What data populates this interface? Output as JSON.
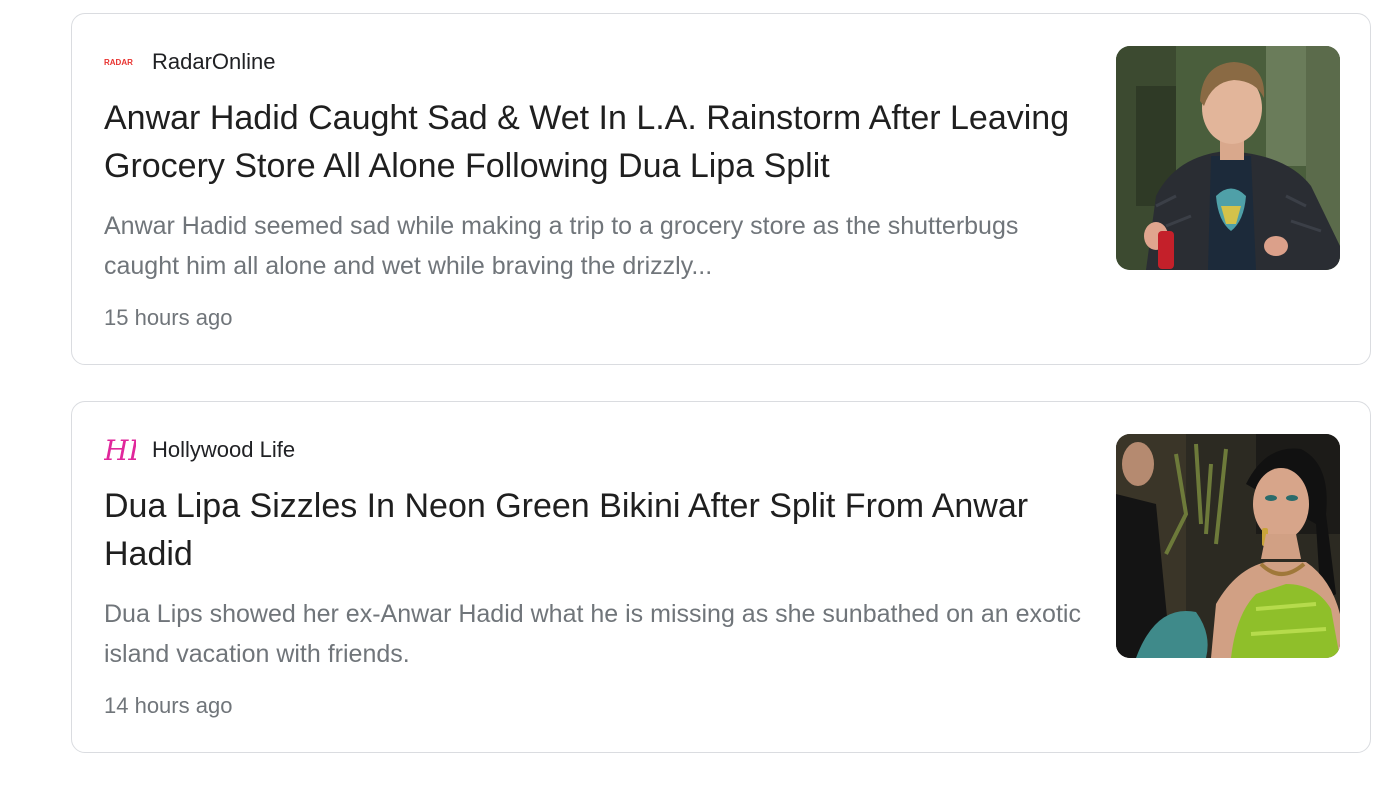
{
  "articles": [
    {
      "source": "RadarOnline",
      "logo_text": "RADAR",
      "logo_color": "#e8322f",
      "headline": "Anwar Hadid Caught Sad & Wet In L.A. Rainstorm After Leaving Grocery Store All Alone Following Dua Lipa Split",
      "snippet": "Anwar Hadid seemed sad while making a trip to a grocery store as the shutterbugs caught him all alone and wet while braving the drizzly...",
      "time": "15 hours ago",
      "thumbnail_icon": "news-photo-young-man-in-jacket"
    },
    {
      "source": "Hollywood Life",
      "logo_text": "HL",
      "logo_color": "#e0279b",
      "headline": "Dua Lipa Sizzles In Neon Green Bikini After Split From Anwar Hadid",
      "snippet": "Dua Lips showed her ex-Anwar Hadid what he is missing as she sunbathed on an exotic island vacation with friends.",
      "time": "14 hours ago",
      "thumbnail_icon": "news-photo-woman-in-green-dress"
    }
  ],
  "colors": {
    "card_border": "#dadce0",
    "headline": "#1f1f1f",
    "secondary_text": "#70757a"
  }
}
